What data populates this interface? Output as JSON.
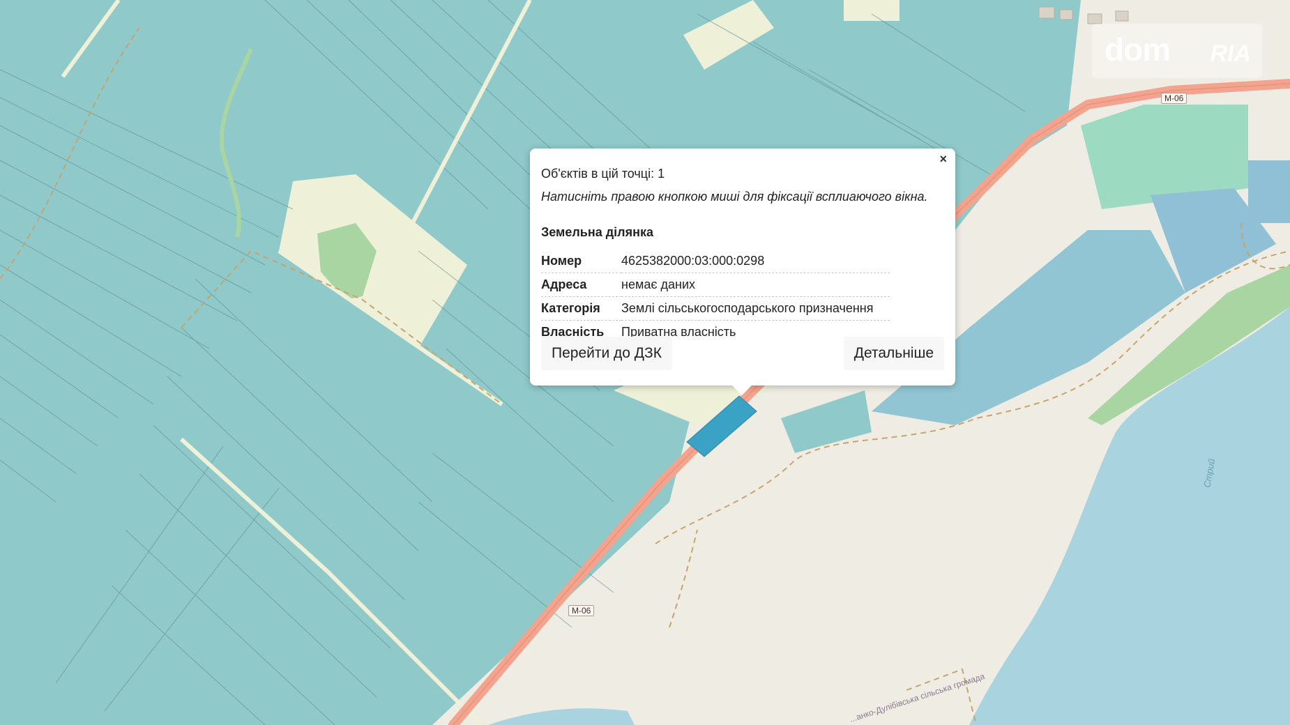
{
  "popup": {
    "count_text": "Об'єктів в цій точці: 1",
    "hint_text": "Натисніть правою кнопкою миші для фіксації всплиаючого вікна.",
    "close_label": "×",
    "section_title": "Земельна ділянка",
    "properties": [
      {
        "key": "Номер",
        "value": "4625382000:03:000:0298"
      },
      {
        "key": "Адреса",
        "value": "немає даних"
      },
      {
        "key": "Категорія",
        "value": "Землі сільськогосподарського призначення"
      },
      {
        "key": "Власність",
        "value": "Приватна власність"
      }
    ],
    "buttons": {
      "dzk": "Перейти до ДЗК",
      "details": "Детальніше"
    }
  },
  "map": {
    "road_labels": [
      "М-06",
      "М-06"
    ],
    "water_labels": [
      "Стрий"
    ],
    "boundary_label": "...анко-Дулібівська сільська громада",
    "colors": {
      "agricultural_parcel": "#8fc9c9",
      "selected_parcel": "#3aa3c5",
      "highway": "#f2a48f",
      "water": "#a9d3de",
      "meadow": "#a8d5a2"
    }
  },
  "logo": {
    "dom": "dom",
    "ria": "RIA"
  }
}
